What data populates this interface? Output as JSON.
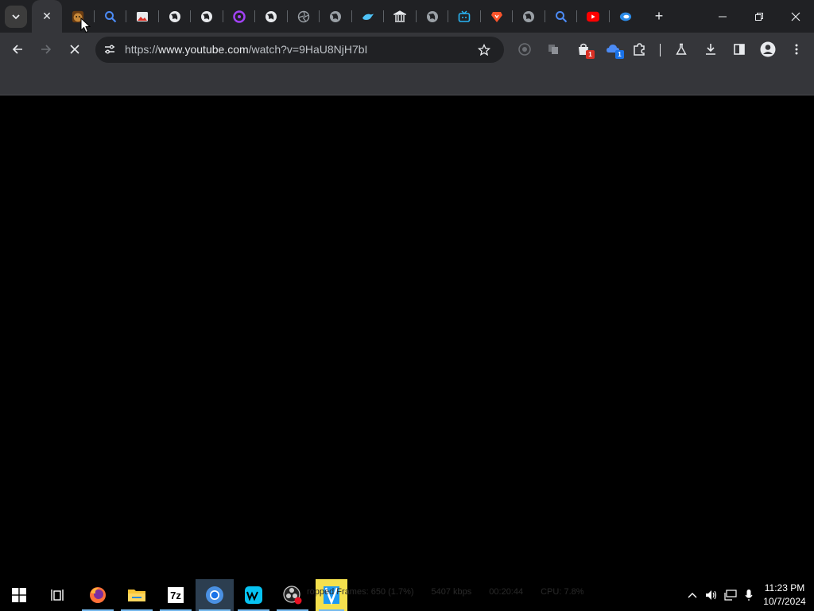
{
  "browser": {
    "active_tab": {
      "title": "",
      "close_glyph": "✕"
    },
    "tabs": [
      {
        "icon": "jester-favicon-icon",
        "color": "#c8893a"
      },
      {
        "icon": "search-favicon-icon",
        "color": "#4c8bf5"
      },
      {
        "icon": "image-favicon-icon",
        "color": "#e8eaed"
      },
      {
        "icon": "globe-favicon-icon",
        "color": "#e8eaed"
      },
      {
        "icon": "globe-favicon-icon",
        "color": "#e8eaed"
      },
      {
        "icon": "ring-favicon-icon",
        "color": "#a142f4"
      },
      {
        "icon": "globe-favicon-icon",
        "color": "#e8eaed"
      },
      {
        "icon": "aperture-favicon-icon",
        "color": "#9aa0a6"
      },
      {
        "icon": "globe-favicon-icon",
        "color": "#9aa0a6"
      },
      {
        "icon": "bird-favicon-icon",
        "color": "#4fc3f7"
      },
      {
        "icon": "bank-favicon-icon",
        "color": "#e8eaed"
      },
      {
        "icon": "globe-favicon-icon",
        "color": "#9aa0a6"
      },
      {
        "icon": "tv-favicon-icon",
        "color": "#29b6f6"
      },
      {
        "icon": "brave-favicon-icon",
        "color": "#fb542b"
      },
      {
        "icon": "globe-favicon-icon",
        "color": "#9aa0a6"
      },
      {
        "icon": "search-favicon-icon",
        "color": "#4c8bf5"
      },
      {
        "icon": "youtube-favicon-icon",
        "color": "#ff0000"
      },
      {
        "icon": "edge-favicon-icon",
        "color": "#2b8ae6"
      }
    ],
    "new_tab_glyph": "+",
    "omnibox": {
      "scheme": "https://",
      "host": "www.youtube.com",
      "path": "/watch?v=9HaU8NjH7bI"
    },
    "extension_badges": {
      "ext1": "1",
      "ext2": "1"
    }
  },
  "taskbar": {
    "apps": [
      "start-icon",
      "task-view-icon",
      "firefox-icon",
      "file-explorer-icon",
      "7zip-icon",
      "chrome-icon",
      "webstorm-icon",
      "obs-icon",
      "kdenlive-icon"
    ],
    "zip_label": "7z",
    "obs_stats": [
      "ropped Frames: 650 (1.7%)",
      "5407 kbps",
      "00:20:44",
      "CPU: 7.8%"
    ],
    "clock": {
      "time": "11:23 PM",
      "date": "10/7/2024"
    }
  },
  "colors": {
    "tabstrip_bg": "#202124",
    "toolbar_bg": "#35363a",
    "omnibox_bg": "#202124",
    "taskbar_bg": "#000000",
    "content_bg": "#000000"
  }
}
